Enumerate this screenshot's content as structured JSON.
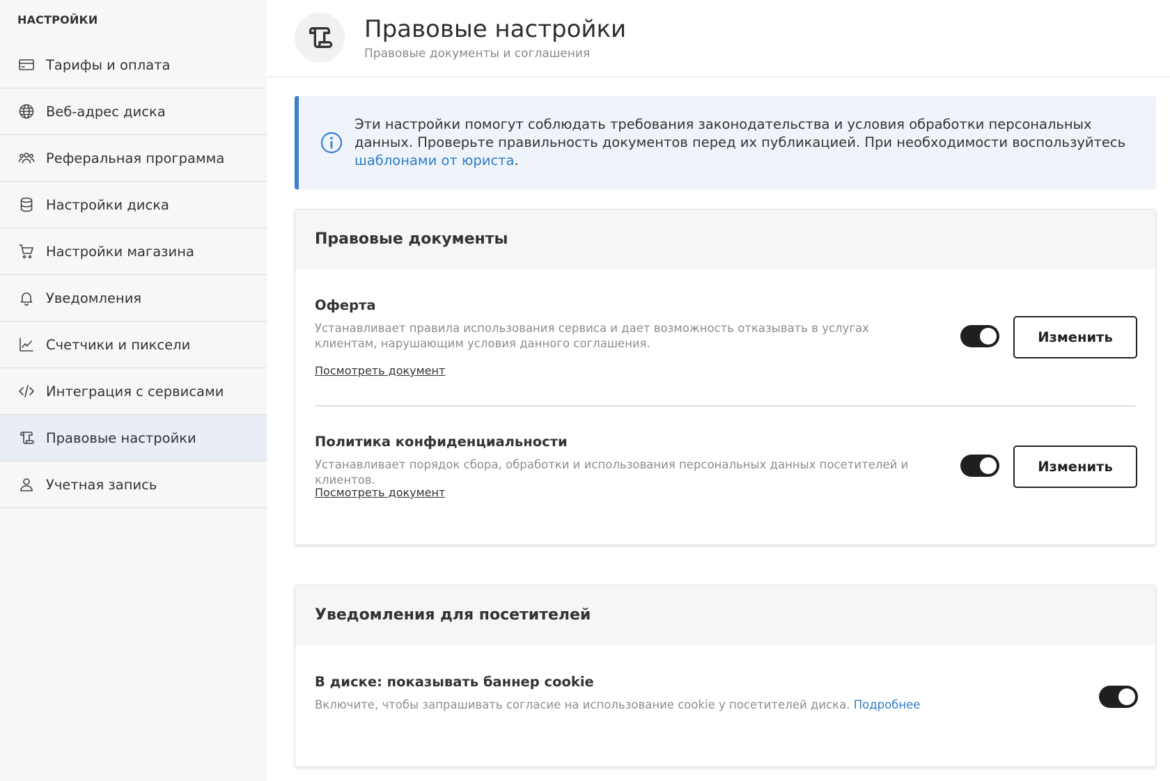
{
  "sidebar": {
    "heading": "НАСТРОЙКИ",
    "items": [
      {
        "label": "Тарифы и оплата",
        "icon": "credit-card-icon"
      },
      {
        "label": "Веб-адрес диска",
        "icon": "globe-icon"
      },
      {
        "label": "Реферальная программа",
        "icon": "users-icon"
      },
      {
        "label": "Настройки диска",
        "icon": "database-icon"
      },
      {
        "label": "Настройки магазина",
        "icon": "cart-icon"
      },
      {
        "label": "Уведомления",
        "icon": "bell-icon"
      },
      {
        "label": "Счетчики и пиксели",
        "icon": "chart-line-icon"
      },
      {
        "label": "Интеграция с сервисами",
        "icon": "code-icon"
      },
      {
        "label": "Правовые настройки",
        "icon": "scroll-icon",
        "active": true
      },
      {
        "label": "Учетная запись",
        "icon": "user-icon"
      }
    ]
  },
  "header": {
    "title": "Правовые настройки",
    "subtitle": "Правовые документы и соглашения",
    "icon": "scroll-icon"
  },
  "info": {
    "text_before": "Эти настройки помогут соблюдать требования законодательства и условия обработки персональных данных. Проверьте правильность документов перед их публикацией. При необходимости воспользуйтесь ",
    "link_text": "шаблонами от юриста",
    "text_after": ".",
    "icon": "info-icon"
  },
  "legal_docs": {
    "title": "Правовые документы",
    "offer": {
      "title": "Оферта",
      "description": "Устанавливает правила использования сервиса и дает возможность отказывать в услугах клиентам, нарушающим условия данного соглашения.",
      "view_link": "Посмотреть документ",
      "enabled": true,
      "edit_label": "Изменить"
    },
    "privacy": {
      "title": "Политика конфиденциальности",
      "description": "Устанавливает порядок сбора, обработки и использования персональных данных посетителей и клиентов.",
      "view_link": "Посмотреть документ",
      "enabled": true,
      "edit_label": "Изменить"
    }
  },
  "visitor_notifications": {
    "title": "Уведомления для посетителей",
    "cookie": {
      "title": "В диске: показывать баннер cookie",
      "description": "Включите, чтобы запрашивать согласие на использование cookie у посетителей диска.",
      "more_link": "Подробнее",
      "enabled": true
    }
  },
  "colors": {
    "accent": "#2f7bc8",
    "info_border": "#3a7fd0",
    "info_bg": "#eef4fa",
    "toggle_on": "#1f1f1f",
    "active_nav_bg": "#e9edf5"
  }
}
